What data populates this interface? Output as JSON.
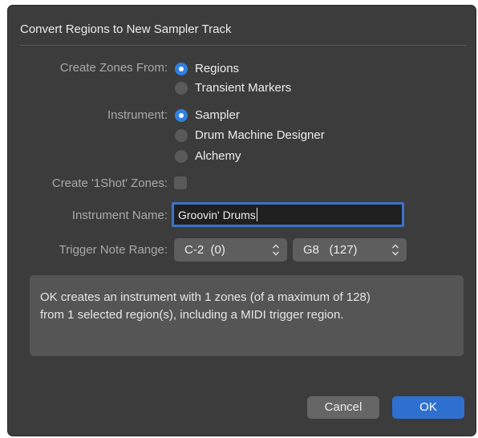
{
  "dialog": {
    "title": "Convert Regions to New Sampler Track"
  },
  "create_zones": {
    "label": "Create Zones From:",
    "options": [
      {
        "label": "Regions",
        "selected": true
      },
      {
        "label": "Transient Markers",
        "selected": false
      }
    ]
  },
  "instrument": {
    "label": "Instrument:",
    "options": [
      {
        "label": "Sampler",
        "selected": true
      },
      {
        "label": "Drum Machine Designer",
        "selected": false
      },
      {
        "label": "Alchemy",
        "selected": false
      }
    ]
  },
  "one_shot": {
    "label": "Create '1Shot' Zones:",
    "checked": false
  },
  "instrument_name": {
    "label": "Instrument Name:",
    "value": "Groovin' Drums"
  },
  "trigger_range": {
    "label": "Trigger Note Range:",
    "low": "C-2  (0)",
    "high": "G8   (127)"
  },
  "info": {
    "line1": "OK creates an instrument with 1 zones (of a maximum of 128)",
    "line2": "from 1 selected region(s), including a MIDI trigger region."
  },
  "buttons": {
    "cancel": "Cancel",
    "ok": "OK"
  },
  "colors": {
    "accent": "#2f80e0",
    "dialog_bg": "#3c3c3c"
  }
}
